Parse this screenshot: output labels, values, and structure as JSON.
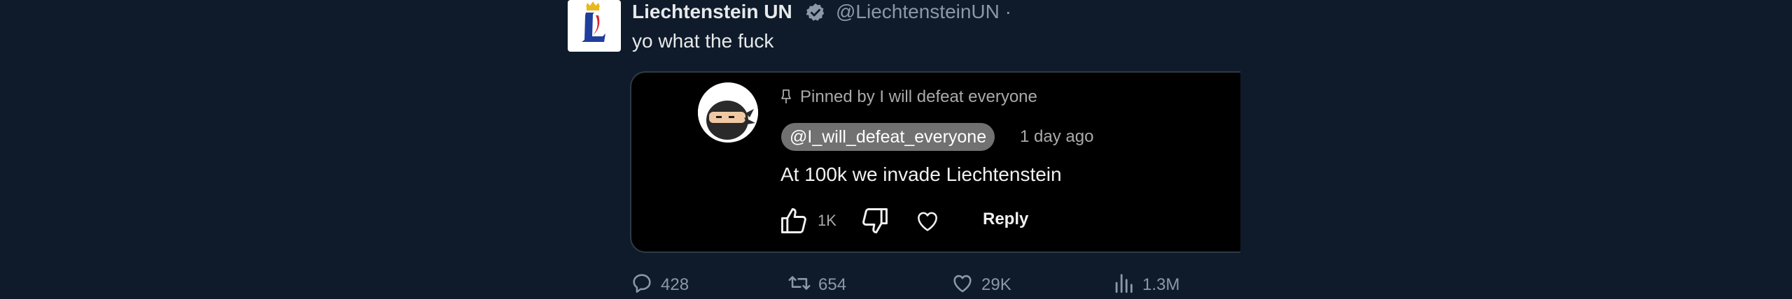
{
  "tweet": {
    "account_name": "Liechtenstein UN",
    "handle": "@LiechtensteinUN ·",
    "text": "yo what the fuck",
    "colors": {
      "background": "#0f1b2b",
      "verified": "#8b98a5",
      "text": "#e7e9ea",
      "muted": "#8b98a5"
    }
  },
  "comment_card": {
    "pinned_label": "Pinned by I will defeat everyone",
    "author_handle": "@I_will_defeat_everyone",
    "time": "1 day ago",
    "text": "At 100k we invade Liechtenstein",
    "like_count": "1K",
    "reply_label": "Reply"
  },
  "stats": {
    "replies": "428",
    "retweets": "654",
    "likes": "29K",
    "views": "1.3M"
  },
  "icons": [
    "verified-badge-icon",
    "pin-icon",
    "thumbs-up-icon",
    "thumbs-down-icon",
    "heart-icon",
    "reply-icon",
    "retweet-icon",
    "like-icon",
    "views-icon"
  ]
}
